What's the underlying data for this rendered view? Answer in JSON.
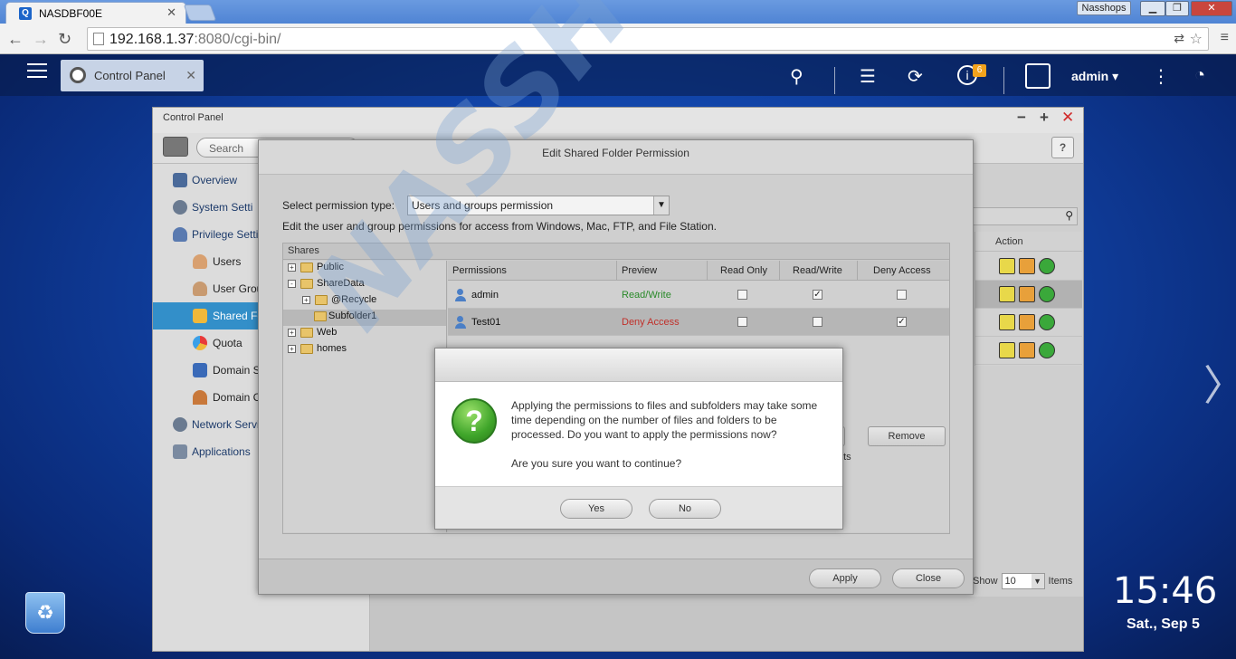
{
  "browser": {
    "tab_title": "NASDBF00E",
    "user_badge": "Nasshops",
    "url_host": "192.168.1.37",
    "url_path": ":8080/cgi-bin/"
  },
  "desktop": {
    "app_tab": "Control Panel",
    "notification_count": "6",
    "user": "admin",
    "time": "15:46",
    "date": "Sat., Sep 5"
  },
  "control_panel": {
    "title": "Control Panel",
    "search_placeholder": "Search",
    "help": "?",
    "sidebar": [
      {
        "label": "Overview",
        "icon": "overview-icon"
      },
      {
        "label": "System Setti",
        "icon": "gear-icon"
      },
      {
        "label": "Privilege Setti",
        "icon": "person-icon"
      },
      {
        "label": "Users",
        "icon": "user-icon"
      },
      {
        "label": "User Grou",
        "icon": "user-group-icon"
      },
      {
        "label": "Shared Fo",
        "icon": "shared-folder-icon"
      },
      {
        "label": "Quota",
        "icon": "quota-icon"
      },
      {
        "label": "Domain S",
        "icon": "domain-security-icon"
      },
      {
        "label": "Domain C",
        "icon": "domain-controller-icon"
      },
      {
        "label": "Network Servi",
        "icon": "globe-icon"
      },
      {
        "label": "Applications",
        "icon": "applications-icon"
      }
    ],
    "action_header": "Action",
    "show_label": "Show",
    "show_value": "10",
    "items_label": "Items"
  },
  "edit_dialog": {
    "title": "Edit Shared Folder Permission",
    "perm_type_label": "Select permission type:",
    "perm_type_value": "Users and groups permission",
    "description": "Edit the user and group permissions for access from Windows, Mac, FTP, and File Station.",
    "shares_header": "Shares",
    "tree": [
      {
        "label": "Public",
        "level": 0,
        "expander": "+"
      },
      {
        "label": "ShareData",
        "level": 0,
        "expander": "-"
      },
      {
        "label": "@Recycle",
        "level": 1,
        "expander": "+"
      },
      {
        "label": "Subfolder1",
        "level": 1,
        "expander": ""
      },
      {
        "label": "Web",
        "level": 0,
        "expander": "+"
      },
      {
        "label": "homes",
        "level": 0,
        "expander": "+"
      }
    ],
    "columns": [
      "Permissions",
      "Preview",
      "Read Only",
      "Read/Write",
      "Deny Access"
    ],
    "rows": [
      {
        "name": "admin",
        "preview": "Read/Write",
        "preview_color": "#2a8a2a",
        "read_only": false,
        "read_write": true,
        "deny": false
      },
      {
        "name": "Test01",
        "preview": "Deny Access",
        "preview_color": "#c0302a",
        "read_only": false,
        "read_write": false,
        "deny": true
      }
    ],
    "remove_label": "Remove",
    "partial_text": "nts",
    "apply_label": "Apply",
    "close_label": "Close"
  },
  "confirm": {
    "message": "Applying the permissions to files and subfolders may take some time depending on the number of files and folders to be processed. Do you want to apply the permissions now?",
    "question": "Are you sure you want to continue?",
    "yes": "Yes",
    "no": "No"
  },
  "watermark": "NASSHOPS.net"
}
